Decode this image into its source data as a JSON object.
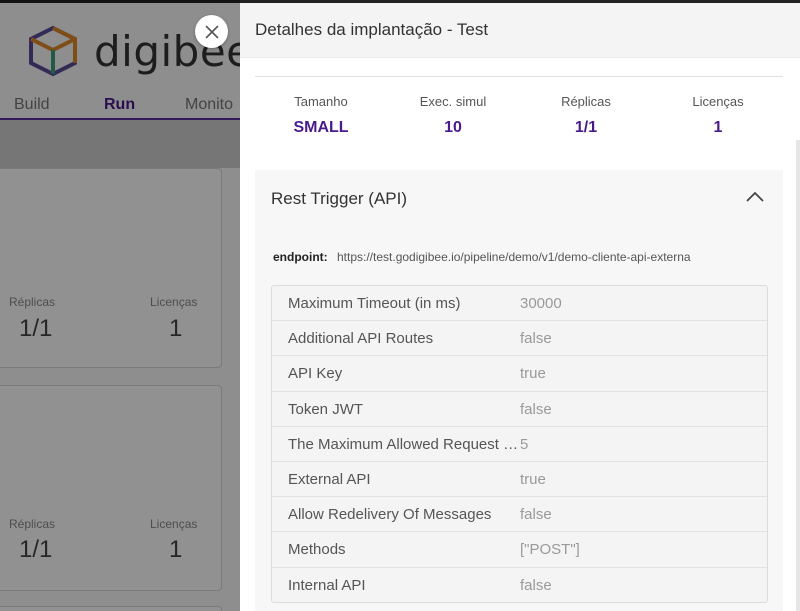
{
  "background": {
    "logo_text": "digibee",
    "nav": {
      "build": "Build",
      "run": "Run",
      "monitor": "Monito"
    },
    "cards": [
      {
        "replicas_label": "Réplicas",
        "replicas_value": "1/1",
        "licenses_label": "Licenças",
        "licenses_value": "1"
      },
      {
        "replicas_label": "Réplicas",
        "replicas_value": "1/1",
        "licenses_label": "Licenças",
        "licenses_value": "1"
      }
    ]
  },
  "drawer": {
    "title": "Detalhes da implantação - Test",
    "stats": [
      {
        "label": "Tamanho",
        "value": "SMALL"
      },
      {
        "label": "Exec. simul",
        "value": "10"
      },
      {
        "label": "Réplicas",
        "value": "1/1"
      },
      {
        "label": "Licenças",
        "value": "1"
      }
    ],
    "trigger": {
      "title": "Rest Trigger (API)",
      "endpoint_label": "endpoint:",
      "endpoint_url": "https://test.godigibee.io/pipeline/demo/v1/demo-cliente-api-externa",
      "properties": [
        {
          "key": "Maximum Timeout (in ms)",
          "value": "30000"
        },
        {
          "key": "Additional API Routes",
          "value": "false"
        },
        {
          "key": "API Key",
          "value": "true"
        },
        {
          "key": "Token JWT",
          "value": "false"
        },
        {
          "key": "The Maximum Allowed Request Size",
          "value": "5"
        },
        {
          "key": "External API",
          "value": "true"
        },
        {
          "key": "Allow Redelivery Of Messages",
          "value": "false"
        },
        {
          "key": "Methods",
          "value": "[\"POST\"]"
        },
        {
          "key": "Internal API",
          "value": "false"
        }
      ]
    }
  },
  "icons": {
    "close": "close-icon",
    "collapse": "chevron-up-icon",
    "logo": "cube-logo-icon"
  },
  "colors": {
    "accent": "#4a1a8c",
    "overlay": "rgba(0,0,0,0.43)"
  }
}
